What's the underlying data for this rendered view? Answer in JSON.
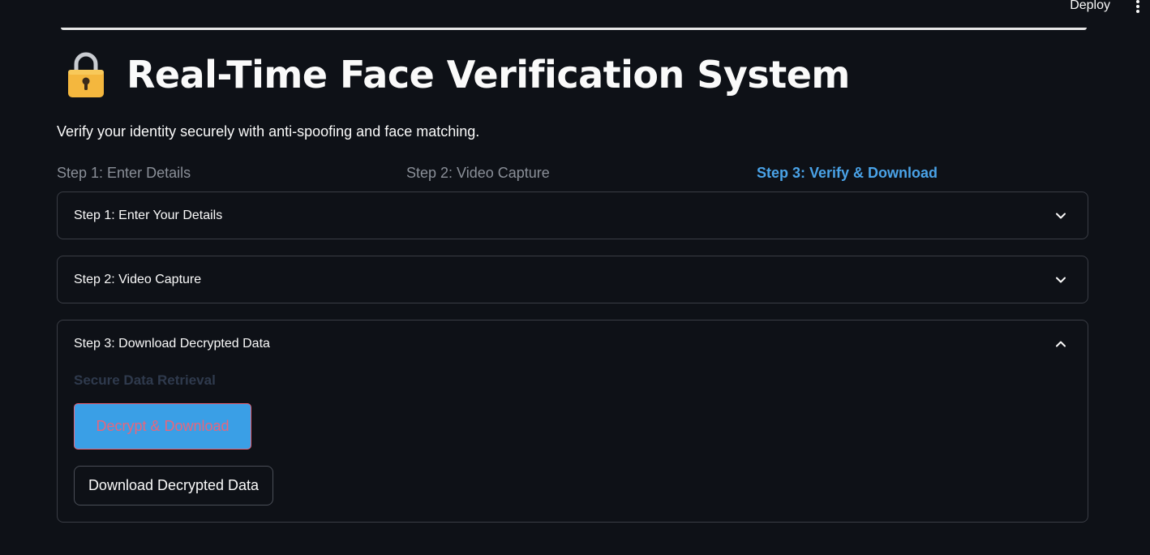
{
  "topbar": {
    "deploy_label": "Deploy",
    "menu_icon": "vertical-dots-icon"
  },
  "header": {
    "icon": "lock-icon",
    "title": "Real-Time Face Verification System",
    "subtitle": "Verify your identity securely with anti-spoofing and face matching."
  },
  "progress": {
    "steps": [
      {
        "label": "Step 1: Enter Details",
        "active": false
      },
      {
        "label": "Step 2: Video Capture",
        "active": false
      },
      {
        "label": "Step 3: Verify & Download",
        "active": true
      }
    ]
  },
  "expanders": [
    {
      "label": "Step 1: Enter Your Details",
      "expanded": false,
      "icon": "chevron-down-icon"
    },
    {
      "label": "Step 2: Video Capture",
      "expanded": false,
      "icon": "chevron-down-icon"
    },
    {
      "label": "Step 3: Download Decrypted Data",
      "expanded": true,
      "icon": "chevron-up-icon",
      "heading": "Secure Data Retrieval",
      "primary_button": "Decrypt & Download",
      "secondary_button": "Download Decrypted Data"
    }
  ],
  "colors": {
    "background": "#0e1117",
    "active_step": "#4aa3e8",
    "primary_button_bg": "#3a9fe6",
    "primary_button_text": "#e7667c",
    "lock_body": "#f4b73e"
  }
}
